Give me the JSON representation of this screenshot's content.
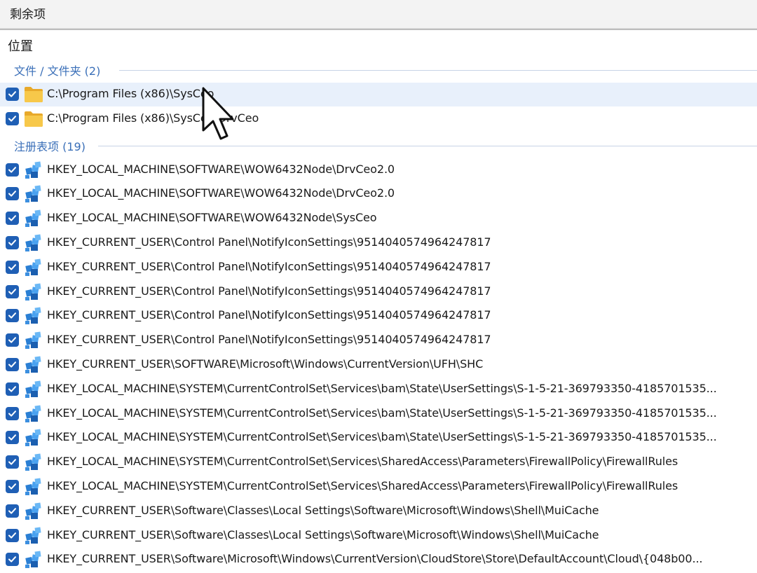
{
  "window": {
    "title": "剩余项"
  },
  "panel": {
    "column_header": "位置",
    "groups": [
      {
        "header": "文件 / 文件夹 (2)",
        "kind": "folder",
        "items": [
          {
            "path": "C:\\Program Files (x86)\\SysCeo",
            "checked": true,
            "selected": true
          },
          {
            "path": "C:\\Program Files (x86)\\SysCeo\\DrvCeo",
            "checked": true,
            "selected": false
          }
        ]
      },
      {
        "header": "注册表项 (19)",
        "kind": "registry",
        "items": [
          {
            "path": "HKEY_LOCAL_MACHINE\\SOFTWARE\\WOW6432Node\\DrvCeo2.0",
            "checked": true
          },
          {
            "path": "HKEY_LOCAL_MACHINE\\SOFTWARE\\WOW6432Node\\DrvCeo2.0",
            "checked": true
          },
          {
            "path": "HKEY_LOCAL_MACHINE\\SOFTWARE\\WOW6432Node\\SysCeo",
            "checked": true
          },
          {
            "path": "HKEY_CURRENT_USER\\Control Panel\\NotifyIconSettings\\9514040574964247817",
            "checked": true
          },
          {
            "path": "HKEY_CURRENT_USER\\Control Panel\\NotifyIconSettings\\9514040574964247817",
            "checked": true
          },
          {
            "path": "HKEY_CURRENT_USER\\Control Panel\\NotifyIconSettings\\9514040574964247817",
            "checked": true
          },
          {
            "path": "HKEY_CURRENT_USER\\Control Panel\\NotifyIconSettings\\9514040574964247817",
            "checked": true
          },
          {
            "path": "HKEY_CURRENT_USER\\Control Panel\\NotifyIconSettings\\9514040574964247817",
            "checked": true
          },
          {
            "path": "HKEY_CURRENT_USER\\SOFTWARE\\Microsoft\\Windows\\CurrentVersion\\UFH\\SHC",
            "checked": true
          },
          {
            "path": "HKEY_LOCAL_MACHINE\\SYSTEM\\CurrentControlSet\\Services\\bam\\State\\UserSettings\\S-1-5-21-369793350-4185701535...",
            "checked": true
          },
          {
            "path": "HKEY_LOCAL_MACHINE\\SYSTEM\\CurrentControlSet\\Services\\bam\\State\\UserSettings\\S-1-5-21-369793350-4185701535...",
            "checked": true
          },
          {
            "path": "HKEY_LOCAL_MACHINE\\SYSTEM\\CurrentControlSet\\Services\\bam\\State\\UserSettings\\S-1-5-21-369793350-4185701535...",
            "checked": true
          },
          {
            "path": "HKEY_LOCAL_MACHINE\\SYSTEM\\CurrentControlSet\\Services\\SharedAccess\\Parameters\\FirewallPolicy\\FirewallRules",
            "checked": true
          },
          {
            "path": "HKEY_LOCAL_MACHINE\\SYSTEM\\CurrentControlSet\\Services\\SharedAccess\\Parameters\\FirewallPolicy\\FirewallRules",
            "checked": true
          },
          {
            "path": "HKEY_CURRENT_USER\\Software\\Classes\\Local Settings\\Software\\Microsoft\\Windows\\Shell\\MuiCache",
            "checked": true
          },
          {
            "path": "HKEY_CURRENT_USER\\Software\\Classes\\Local Settings\\Software\\Microsoft\\Windows\\Shell\\MuiCache",
            "checked": true
          },
          {
            "path": "HKEY_CURRENT_USER\\Software\\Microsoft\\Windows\\CurrentVersion\\CloudStore\\Store\\DefaultAccount\\Cloud\\{048b00...",
            "checked": true
          }
        ]
      }
    ]
  },
  "icons": {
    "folder": "folder-icon",
    "registry": "registry-key-icon",
    "checkbox": "checkmark-icon",
    "cursor": "mouse-pointer-icon"
  },
  "colors": {
    "accent": "#1f5fb5",
    "group_header": "#3a6fb8",
    "selected_row": "#e8f0fb",
    "folder": "#f5c342",
    "registry": "#2a7fd4"
  }
}
